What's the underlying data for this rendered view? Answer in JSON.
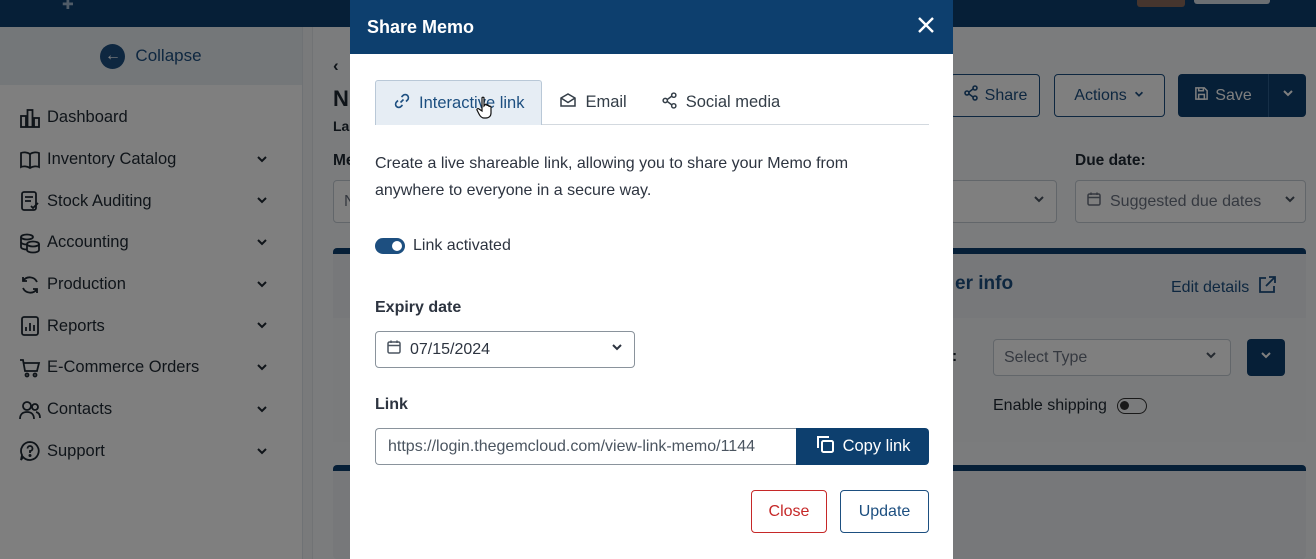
{
  "app": {
    "sidebar": {
      "collapse_label": "Collapse",
      "items": [
        {
          "label": "Dashboard",
          "icon": "chart-bars-icon",
          "has_children": false
        },
        {
          "label": "Inventory Catalog",
          "icon": "book-icon",
          "has_children": true
        },
        {
          "label": "Stock Auditing",
          "icon": "clipboard-check-icon",
          "has_children": true
        },
        {
          "label": "Accounting",
          "icon": "coins-icon",
          "has_children": true
        },
        {
          "label": "Production",
          "icon": "refresh-icon",
          "has_children": true
        },
        {
          "label": "Reports",
          "icon": "report-icon",
          "has_children": true
        },
        {
          "label": "E-Commerce Orders",
          "icon": "cart-icon",
          "has_children": true
        },
        {
          "label": "Contacts",
          "icon": "users-icon",
          "has_children": true
        },
        {
          "label": "Support",
          "icon": "help-icon",
          "has_children": true
        }
      ]
    },
    "header_buttons": {
      "share": "Share",
      "actions": "Actions",
      "save": "Save"
    },
    "partial_labels": {
      "title_fragment": "N",
      "sub_fragment": "La",
      "memo_fragment": "Me",
      "field_fragment": "N"
    },
    "due_date": {
      "label": "Due date:",
      "placeholder": "Suggested due dates"
    },
    "customer_card": {
      "title_fragment": "er info",
      "edit_link": "Edit details",
      "select_type_placeholder": "Select Type",
      "enable_shipping_label": "Enable shipping",
      "colon": ":"
    }
  },
  "modal": {
    "title": "Share Memo",
    "tabs": [
      {
        "label": "Interactive link",
        "icon": "link-icon",
        "active": true
      },
      {
        "label": "Email",
        "icon": "envelope-icon",
        "active": false
      },
      {
        "label": "Social media",
        "icon": "share-nodes-icon",
        "active": false
      }
    ],
    "description": "Create a live shareable link, allowing you to share your Memo from anywhere to everyone in a secure way.",
    "link_activated_label": "Link activated",
    "link_activated": true,
    "expiry_label": "Expiry date",
    "expiry_value": "07/15/2024",
    "link_label": "Link",
    "link_value": "https://login.thegemcloud.com/view-link-memo/1144",
    "copy_button": "Copy link",
    "close_button": "Close",
    "update_button": "Update"
  },
  "colors": {
    "primary": "#0d3f6e",
    "accent": "#1d4f80",
    "danger": "#c62828",
    "tab_active_bg": "#e6edf4"
  }
}
